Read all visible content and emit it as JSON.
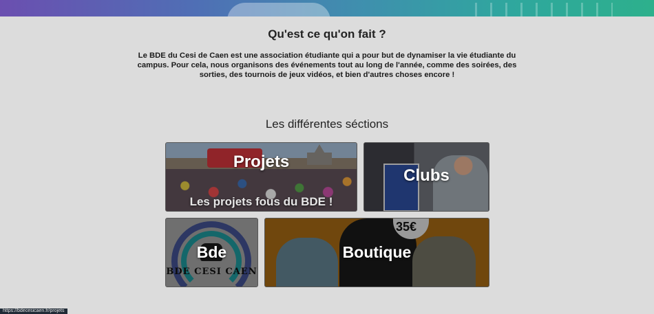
{
  "intro": {
    "title": "Qu'est ce qu'on fait ?",
    "text": "Le BDE du Cesi de Caen est une association étudiante qui a pour but de dynamiser la vie étudiante du campus. Pour cela, nous organisons des événements tout au long de l'année, comme des soirées, des sorties, des tournois de jeux vidéos, et bien d'autres choses encore !"
  },
  "sections": {
    "title": "Les différentes séctions",
    "cards": {
      "projets": {
        "label": "Projets",
        "subtitle": "Les projets fous du BDE !"
      },
      "clubs": {
        "label": "Clubs"
      },
      "bde": {
        "label": "Bde",
        "logo_text": "BDE CESI CAEN"
      },
      "boutique": {
        "label": "Boutique",
        "price": "35€"
      }
    }
  },
  "status_bar": {
    "url": "https://bdecesicaen.fr/projets"
  },
  "colors": {
    "background": "#dcdcdc",
    "hero_gradient_start": "#6b4fb0",
    "hero_gradient_end": "#2db08c"
  }
}
